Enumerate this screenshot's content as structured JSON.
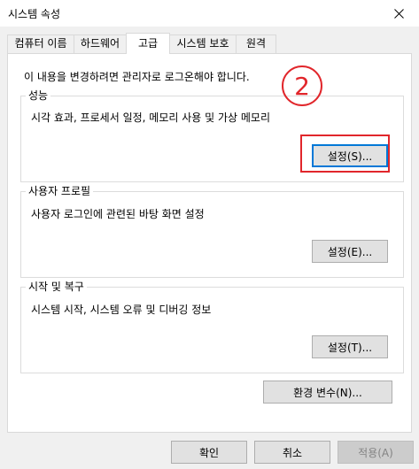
{
  "window": {
    "title": "시스템 속성"
  },
  "tabs": [
    {
      "label": "컴퓨터 이름"
    },
    {
      "label": "하드웨어"
    },
    {
      "label": "고급"
    },
    {
      "label": "시스템 보호"
    },
    {
      "label": "원격"
    }
  ],
  "notice": "이 내용을 변경하려면 관리자로 로그온해야 합니다.",
  "groups": {
    "performance": {
      "title": "성능",
      "description": "시각 효과, 프로세서 일정, 메모리 사용 및 가상 메모리",
      "button": "설정(S)..."
    },
    "user_profiles": {
      "title": "사용자 프로필",
      "description": "사용자 로그인에 관련된 바탕 화면 설정",
      "button": "설정(E)..."
    },
    "startup_recovery": {
      "title": "시작 및 복구",
      "description": "시스템 시작, 시스템 오류 및 디버깅 정보",
      "button": "설정(T)..."
    }
  },
  "env_button": "환경 변수(N)...",
  "footer": {
    "ok": "확인",
    "cancel": "취소",
    "apply": "적용(A)"
  },
  "annotation": {
    "number": "2",
    "color": "#e1262b"
  },
  "colors": {
    "focus_border": "#0078d7",
    "button_bg": "#e1e1e1",
    "window_bg": "#f0f0f0"
  }
}
